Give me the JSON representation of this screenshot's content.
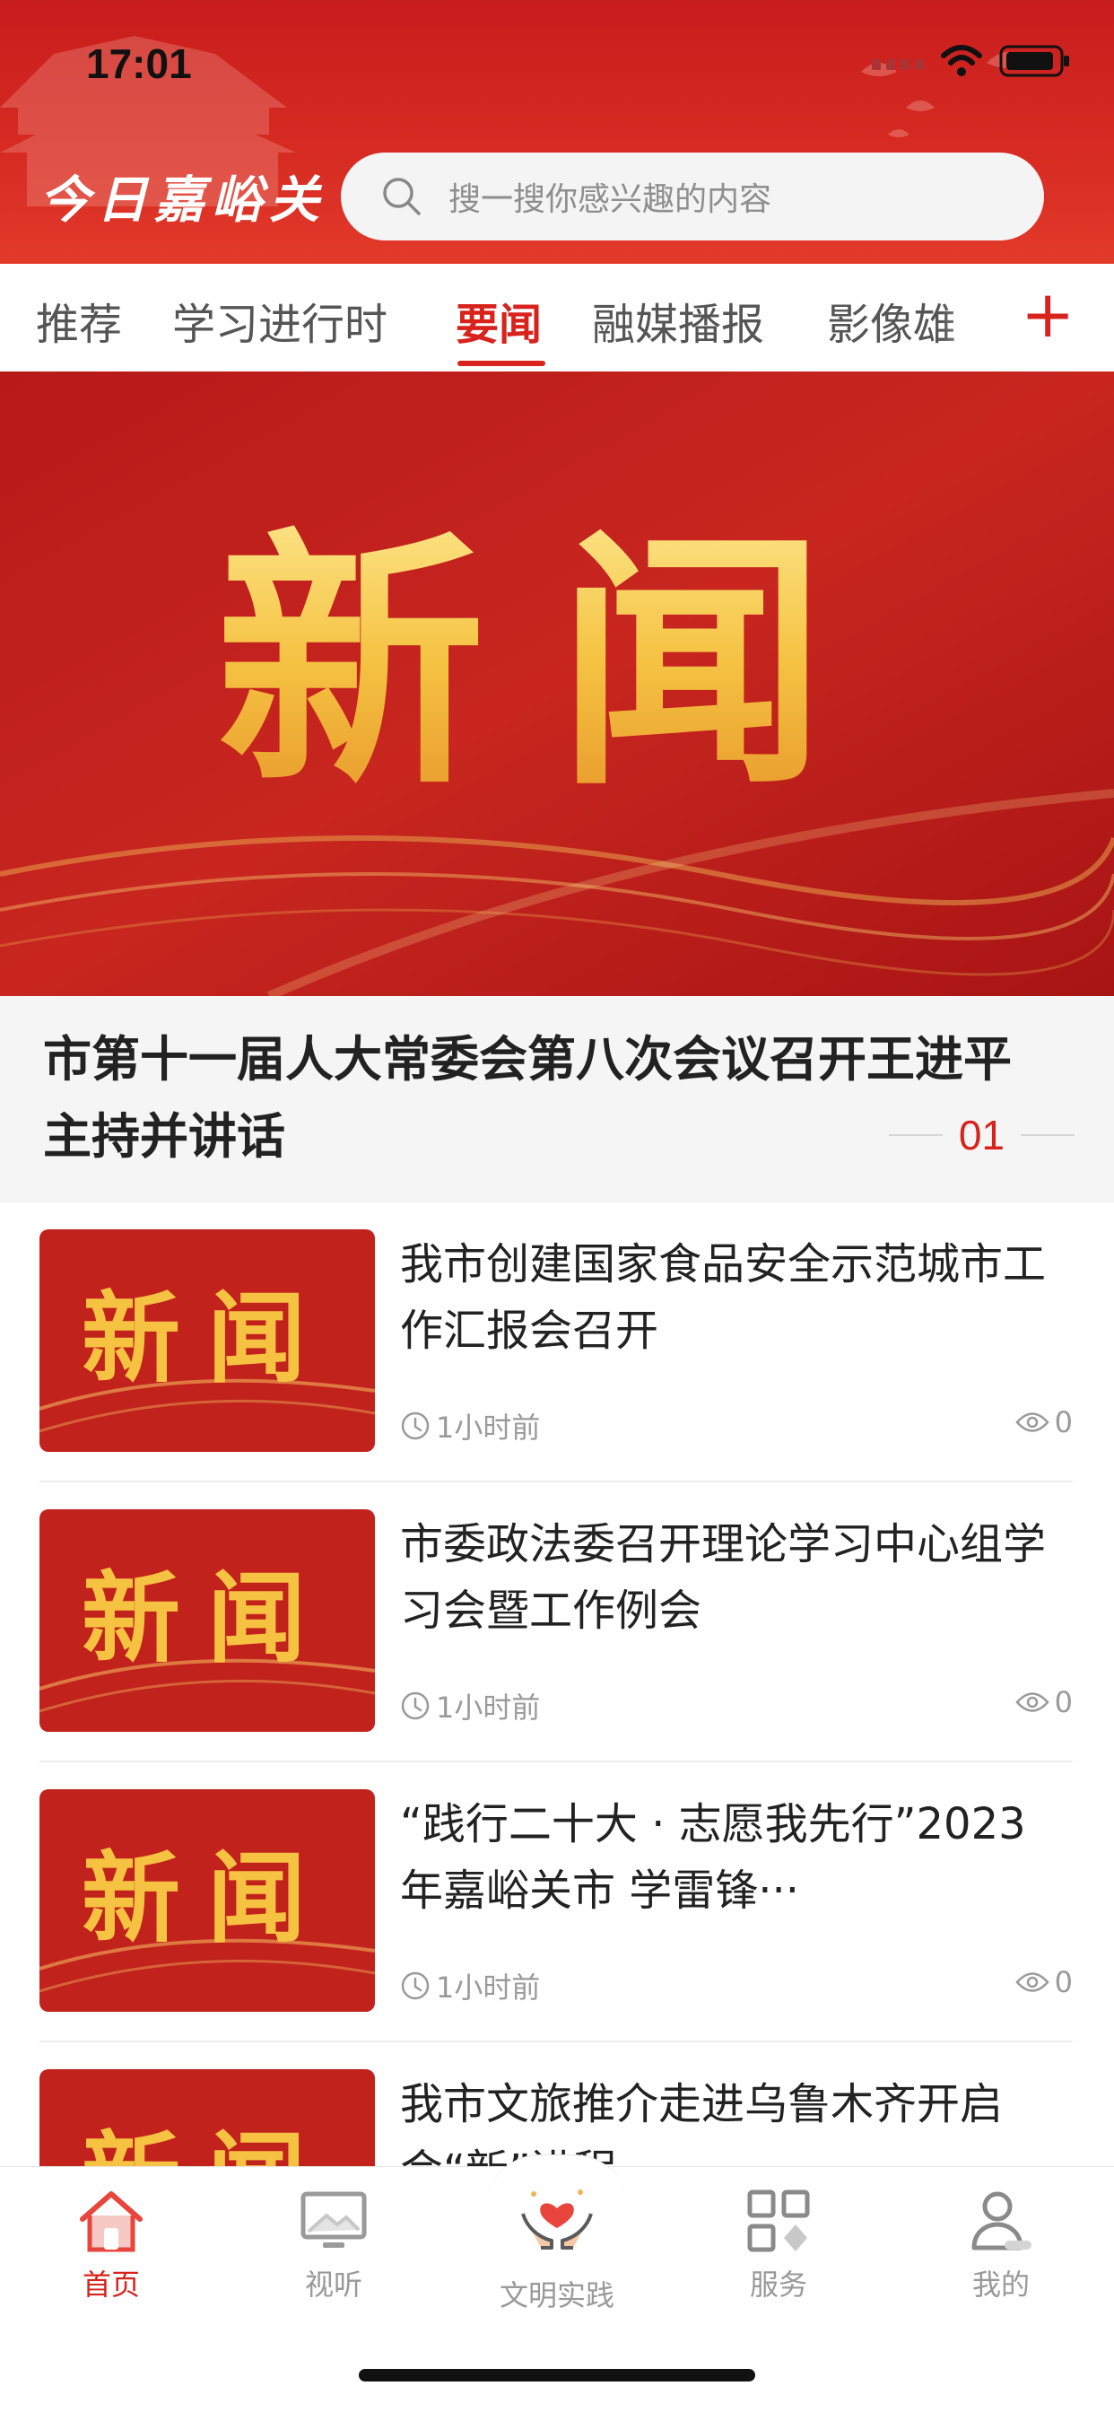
{
  "status_bar": {
    "time": "17:01"
  },
  "header": {
    "logo_text": "今日嘉峪关",
    "search_placeholder": "搜一搜你感兴趣的内容"
  },
  "tabs": [
    {
      "label": "推荐",
      "active": false
    },
    {
      "label": "学习进行时",
      "active": false
    },
    {
      "label": "要闻",
      "active": true
    },
    {
      "label": "融媒播报",
      "active": false
    },
    {
      "label": "影像雄",
      "active": false
    }
  ],
  "banner": {
    "image_text": "新闻",
    "title": "市第十一届人大常委会第八次会议召开王进平主持并讲话",
    "index": "01"
  },
  "news_items": [
    {
      "thumb_text": "新闻",
      "title": "我市创建国家食品安全示范城市工作汇报会召开",
      "time": "1小时前",
      "views": "0"
    },
    {
      "thumb_text": "新闻",
      "title": "市委政法委召开理论学习中心组学习会暨工作例会",
      "time": "1小时前",
      "views": "0"
    },
    {
      "thumb_text": "新闻",
      "title": "“践行二十大 · 志愿我先行”2023年嘉峪关市 学雷锋···",
      "time": "1小时前",
      "views": "0"
    },
    {
      "thumb_text": "新闻",
      "title": "我市文旅推介走进乌鲁木齐开启会“新”进程",
      "time": "",
      "views": ""
    }
  ],
  "bottom_nav": [
    {
      "label": "首页",
      "icon": "home-icon",
      "active": true
    },
    {
      "label": "视听",
      "icon": "tv-icon",
      "active": false
    },
    {
      "label": "文明实践",
      "icon": "heart-hands-icon",
      "active": false
    },
    {
      "label": "服务",
      "icon": "grid-icon",
      "active": false
    },
    {
      "label": "我的",
      "icon": "user-icon",
      "active": false
    }
  ],
  "colors": {
    "brand_red": "#d8231d",
    "header_red": "#d62a22",
    "gold": "#f5c242"
  }
}
